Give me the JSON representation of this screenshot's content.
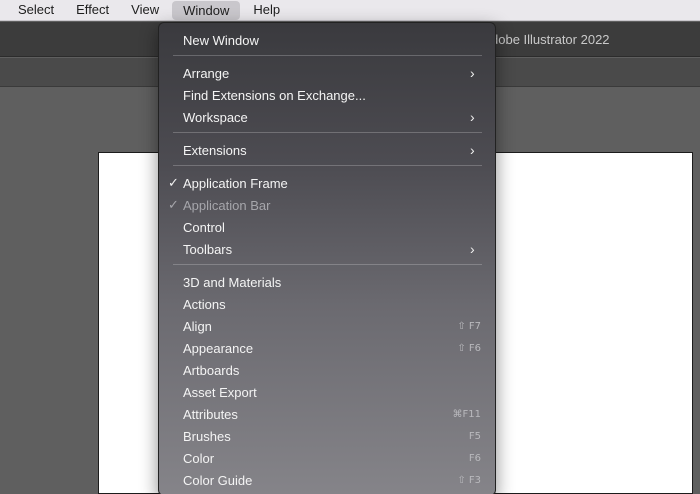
{
  "menubar": {
    "items": [
      {
        "label": "Select"
      },
      {
        "label": "Effect"
      },
      {
        "label": "View"
      },
      {
        "label": "Window"
      },
      {
        "label": "Help"
      }
    ],
    "active": "Window"
  },
  "app": {
    "title": "dobe Illustrator 2022"
  },
  "window_menu": {
    "items": [
      {
        "label": "New Window"
      },
      {
        "label": "Arrange",
        "submenu_icon": "chevron-right-icon"
      },
      {
        "label": "Find Extensions on Exchange..."
      },
      {
        "label": "Workspace",
        "submenu_icon": "chevron-right-icon"
      },
      {
        "label": "Extensions",
        "submenu_icon": "chevron-right-icon"
      },
      {
        "label": "Application Frame",
        "checked": true,
        "check_icon": "checkmark-icon"
      },
      {
        "label": "Application Bar",
        "checked": true,
        "disabled": true,
        "check_icon": "checkmark-icon"
      },
      {
        "label": "Control"
      },
      {
        "label": "Toolbars",
        "submenu_icon": "chevron-right-icon"
      },
      {
        "label": "3D and Materials"
      },
      {
        "label": "Actions"
      },
      {
        "label": "Align",
        "shortcut": "⇧ F7"
      },
      {
        "label": "Appearance",
        "shortcut": "⇧ F6"
      },
      {
        "label": "Artboards"
      },
      {
        "label": "Asset Export"
      },
      {
        "label": "Attributes",
        "shortcut": "⌘F11"
      },
      {
        "label": "Brushes",
        "shortcut": "F5"
      },
      {
        "label": "Color",
        "shortcut": "F6"
      },
      {
        "label": "Color Guide",
        "shortcut": "⇧ F3"
      }
    ],
    "chevron_glyph": "›",
    "check_glyph": "✓"
  },
  "colors": {
    "menubar_bg": "#eae8ec",
    "app_chrome": "#3c3c3c",
    "canvas_bg": "#5f5f5f",
    "artboard": "#ffffff",
    "menu_text": "#f4f4f4",
    "menu_disabled_text": "#a6a6ab"
  }
}
